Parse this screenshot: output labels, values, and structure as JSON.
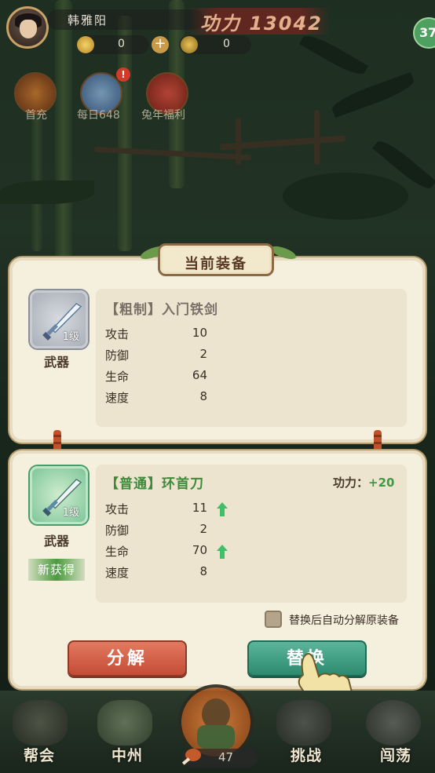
{
  "player": {
    "name": "韩雅阳"
  },
  "power_display": "功力 13042",
  "currency": {
    "coins": "0",
    "gems": "0"
  },
  "level": "37",
  "events": [
    {
      "label": "首充",
      "icon": "red-pouch-icon"
    },
    {
      "label": "每日648",
      "icon": "treasure-bag-icon",
      "badge": "!"
    },
    {
      "label": "兔年福利",
      "icon": "rabbit-lantern-icon"
    }
  ],
  "current_equipment": {
    "title": "当前装备",
    "slot_level": "1级",
    "category": "武器",
    "name": "【粗制】入门铁剑",
    "stats": [
      {
        "key": "攻击",
        "value": "10"
      },
      {
        "key": "防御",
        "value": "2"
      },
      {
        "key": "生命",
        "value": "64"
      },
      {
        "key": "速度",
        "value": "8"
      }
    ]
  },
  "new_equipment": {
    "slot_level": "1级",
    "category": "武器",
    "new_tag": "新获得",
    "name": "【普通】环首刀",
    "power_label": "功力：",
    "power_delta": "+20",
    "stats": [
      {
        "key": "攻击",
        "value": "11",
        "up": true
      },
      {
        "key": "防御",
        "value": "2",
        "up": false
      },
      {
        "key": "生命",
        "value": "70",
        "up": true
      },
      {
        "key": "速度",
        "value": "8",
        "up": false
      }
    ]
  },
  "auto_decompose_label": "替换后自动分解原装备",
  "buttons": {
    "decompose": "分解",
    "replace": "替换"
  },
  "bottom_nav": [
    {
      "label": "帮会"
    },
    {
      "label": "中州"
    },
    {
      "label": "挑战"
    },
    {
      "label": "闯荡"
    }
  ],
  "stamina": "47",
  "colors": {
    "panel_bg": "#f5efde",
    "accent_green": "#3f9a44",
    "button_red": "#c54c35",
    "button_teal": "#2e8a6e"
  }
}
